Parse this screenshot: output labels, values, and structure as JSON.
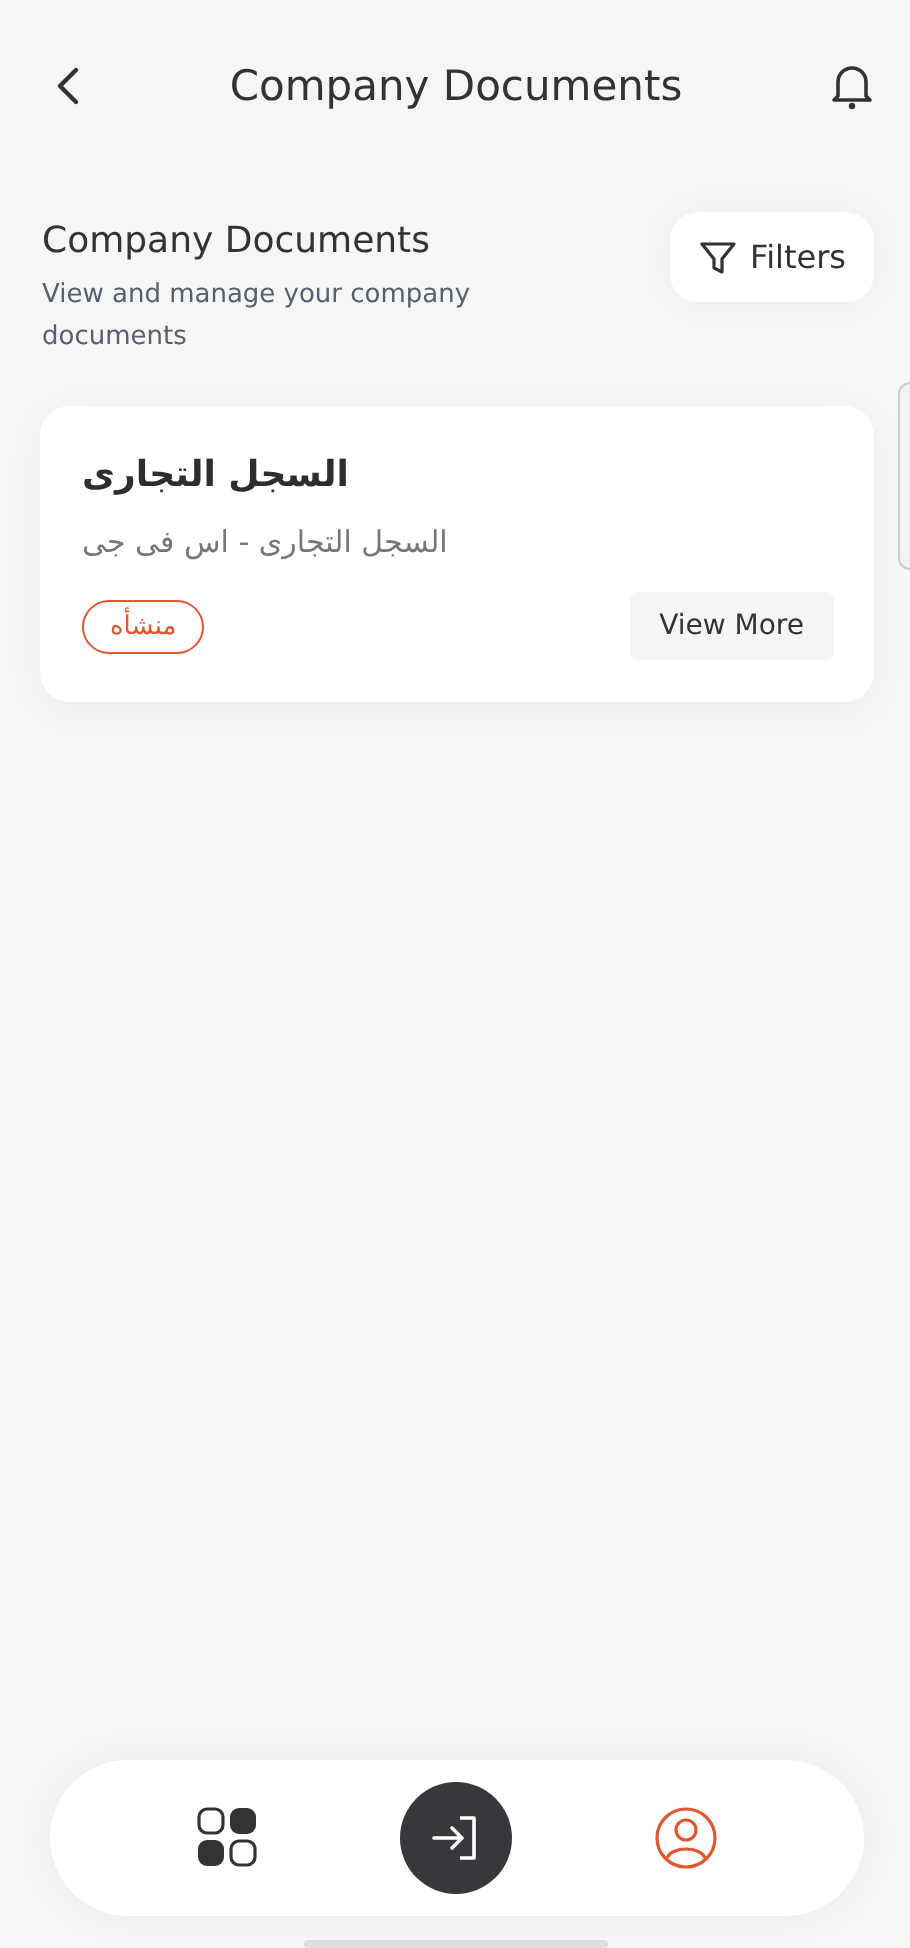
{
  "header": {
    "title": "Company Documents"
  },
  "section": {
    "title": "Company Documents",
    "subtitle": "View and manage your company documents",
    "filter_label": "Filters"
  },
  "documents": [
    {
      "title": "السجل التجارى",
      "subtitle": "السجل التجارى - اس فى جى",
      "tag": "منشأه",
      "action": "View More"
    }
  ],
  "nav": [
    {
      "kind": "apps",
      "selected": false
    },
    {
      "kind": "login",
      "selected": false
    },
    {
      "kind": "profile",
      "selected": true
    }
  ]
}
